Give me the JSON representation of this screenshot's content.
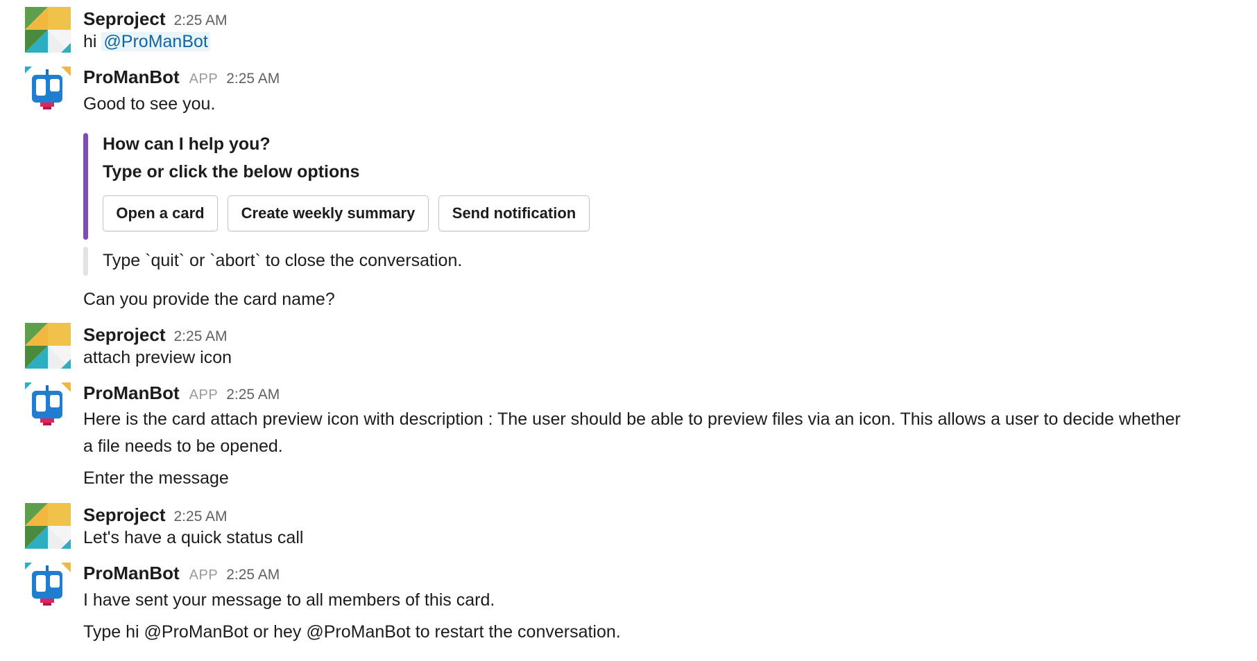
{
  "colors": {
    "attachment_bar": "#7c4fb0",
    "footer_bar": "#e2e2e2",
    "mention_bg": "#eaf5fb",
    "mention_fg": "#1264a3"
  },
  "icons": {
    "user_avatar": "seproject-avatar-icon",
    "bot_avatar": "promanbot-robot-avatar-icon"
  },
  "messages": [
    {
      "author": "Seproject",
      "time": "2:25 AM",
      "text_prefix": "hi",
      "mention": "@ProManBot"
    },
    {
      "author": "ProManBot",
      "badge": "APP",
      "time": "2:25 AM",
      "text": "Good to see you.",
      "attachment": {
        "title": "How can I help you?",
        "subtitle": "Type or click the below options",
        "buttons": [
          "Open a card",
          "Create weekly summary",
          "Send notification"
        ]
      },
      "footer": "Type `quit` or `abort` to close the conversation.",
      "followup": "Can you provide the card name?"
    },
    {
      "author": "Seproject",
      "time": "2:25 AM",
      "text": "attach preview icon"
    },
    {
      "author": "ProManBot",
      "badge": "APP",
      "time": "2:25 AM",
      "text": "Here is the card attach preview icon with description : The user should be able to preview files via an icon. This allows a user to decide whether a file needs to be opened.",
      "followup": "Enter the message"
    },
    {
      "author": "Seproject",
      "time": "2:25 AM",
      "text": "Let's have a quick status call"
    },
    {
      "author": "ProManBot",
      "badge": "APP",
      "time": "2:25 AM",
      "text": "I have sent your message to all members of this card.",
      "followup": "Type hi @ProManBot or hey @ProManBot to restart the conversation."
    }
  ]
}
